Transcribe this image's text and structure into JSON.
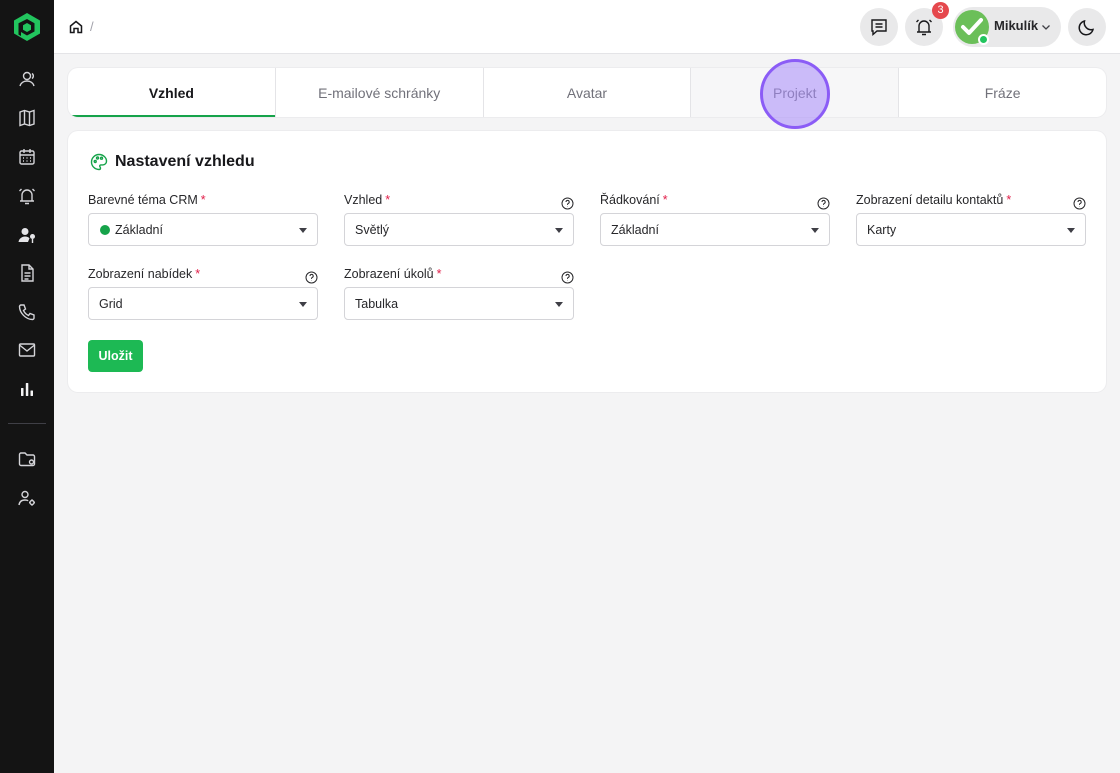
{
  "sidebar": {
    "items": [
      {
        "icon": "contacts-icon"
      },
      {
        "icon": "map-icon"
      },
      {
        "icon": "calendar-icon"
      },
      {
        "icon": "alarm-icon"
      },
      {
        "icon": "user-pin-icon"
      },
      {
        "icon": "document-icon"
      },
      {
        "icon": "phone-icon"
      },
      {
        "icon": "mail-icon"
      },
      {
        "icon": "chart-icon"
      },
      {
        "icon": "folder-settings-icon"
      },
      {
        "icon": "users-settings-icon"
      }
    ]
  },
  "header": {
    "breadcrumb_separator": "/",
    "notification_count": "3",
    "user_name": "Mikulík"
  },
  "tabs": [
    "Vzhled",
    "E-mailové schránky",
    "Avatar",
    "Projekt",
    "Fráze"
  ],
  "card": {
    "title": "Nastavení vzhledu",
    "fields": [
      {
        "label": "Barevné téma CRM",
        "value": "Základní"
      },
      {
        "label": "Vzhled",
        "value": "Světlý"
      },
      {
        "label": "Řádkování",
        "value": "Základní"
      },
      {
        "label": "Zobrazení detailu kontaktů",
        "value": "Karty"
      },
      {
        "label": "Zobrazení nabídek",
        "value": "Grid"
      },
      {
        "label": "Zobrazení úkolů",
        "value": "Tabulka"
      }
    ],
    "required_mark": "*",
    "save_label": "Uložit"
  },
  "colors": {
    "accent": "#16a34a",
    "sidebar_bg": "#141414",
    "button": "#1db954",
    "required": "#e11d48",
    "badge": "#e5484d"
  }
}
